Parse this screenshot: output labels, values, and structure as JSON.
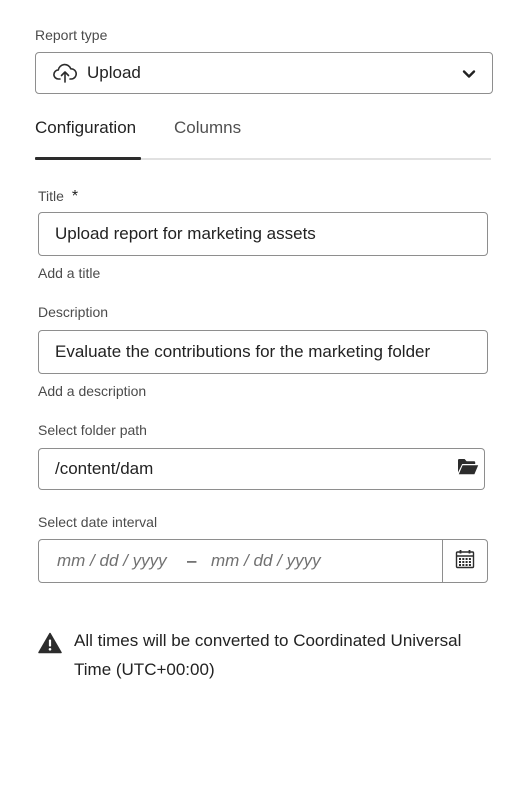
{
  "report_type": {
    "label": "Report type",
    "selected_value": "Upload",
    "icon": "cloud-upload-icon"
  },
  "tabs": [
    {
      "label": "Configuration",
      "selected": true
    },
    {
      "label": "Columns",
      "selected": false
    }
  ],
  "title_field": {
    "label": "Title",
    "required_marker": "*",
    "value": "Upload report for marketing assets",
    "help_text": "Add a title"
  },
  "description_field": {
    "label": "Description",
    "value": "Evaluate the contributions for the marketing folder",
    "help_text": "Add a description"
  },
  "folder_path": {
    "label": "Select folder path",
    "value": "/content/dam",
    "button_icon": "folder-open-icon"
  },
  "date_interval": {
    "label": "Select date interval",
    "start_placeholder": "mm / dd / yyyy",
    "separator": "–",
    "end_placeholder": "mm / dd / yyyy",
    "button_icon": "calendar-icon"
  },
  "notice": {
    "icon": "warning-icon",
    "text": "All times will be converted to Coordinated Universal Time (UTC+00:00)"
  }
}
